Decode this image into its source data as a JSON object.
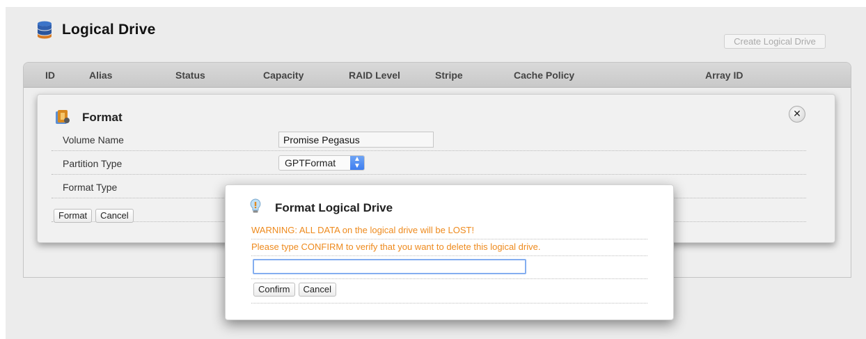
{
  "page": {
    "title": "Logical Drive",
    "create_button": "Create Logical Drive"
  },
  "table": {
    "columns": [
      "ID",
      "Alias",
      "Status",
      "Capacity",
      "RAID Level",
      "Stripe",
      "Cache Policy",
      "Array ID"
    ]
  },
  "format_panel": {
    "title": "Format",
    "rows": {
      "volume_name_label": "Volume Name",
      "volume_name_value": "Promise Pegasus",
      "partition_type_label": "Partition Type",
      "partition_type_value": "GPTFormat",
      "format_type_label": "Format Type"
    },
    "format_button": "Format",
    "cancel_button": "Cancel"
  },
  "dialog": {
    "title": "Format Logical Drive",
    "warning": "WARNING: ALL DATA on the logical drive will be LOST!",
    "instruction": "Please type CONFIRM to verify that you want to delete this logical drive.",
    "confirm_value": "",
    "confirm_button": "Confirm",
    "cancel_button": "Cancel"
  },
  "colors": {
    "warning": "#ee8a1d",
    "accent": "#3e7ef0"
  },
  "icons": [
    "database-icon",
    "format-icon",
    "close-icon",
    "lightbulb-icon",
    "chevron-updown-icon"
  ]
}
